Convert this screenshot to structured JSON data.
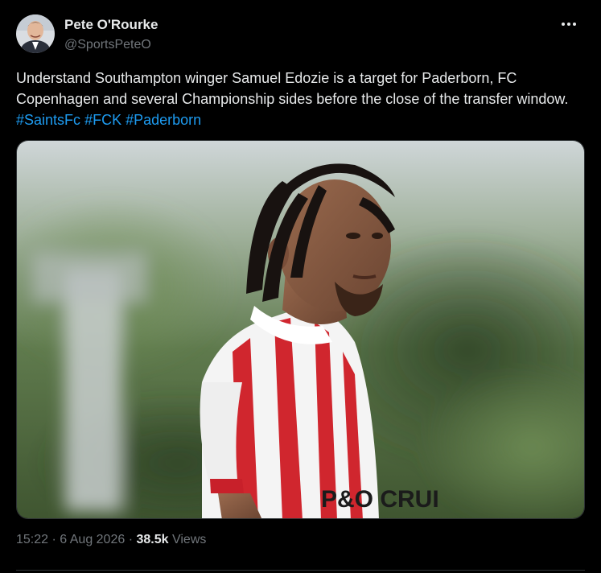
{
  "author": {
    "display_name": "Pete O'Rourke",
    "handle": "@SportsPeteO"
  },
  "tweet": {
    "text": "Understand Southampton winger Samuel Edozie is a target for Paderborn, FC Copenhagen and several Championship sides before the close of the transfer window.",
    "hashtags": [
      "#SaintsFc",
      "#FCK",
      "#Paderborn"
    ],
    "sponsor_text": "P&O CRUI"
  },
  "meta": {
    "time": "15:22",
    "separator": "·",
    "date": "6 Aug 2026",
    "views_count": "38.5k",
    "views_label": "Views"
  },
  "colors": {
    "background": "#000000",
    "text_primary": "#e7e9ea",
    "text_secondary": "#71767b",
    "link": "#1d9bf0",
    "border": "#2f3336"
  },
  "icons": {
    "more": "more-horizontal-icon"
  }
}
